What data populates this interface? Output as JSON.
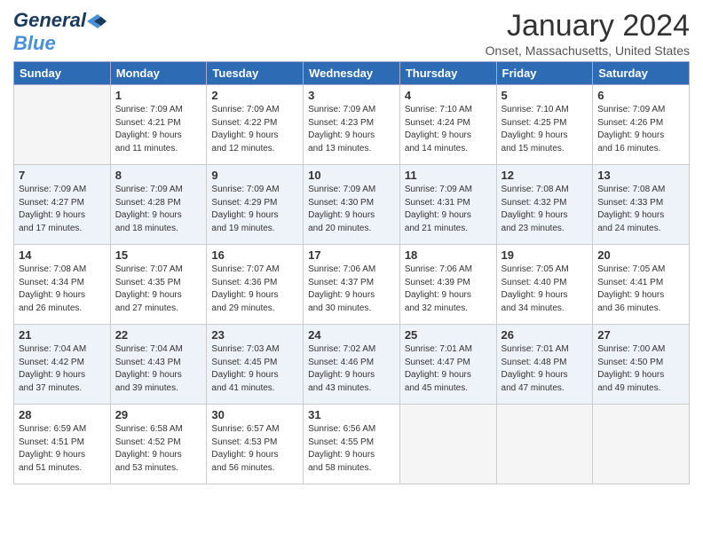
{
  "header": {
    "logo_general": "General",
    "logo_blue": "Blue",
    "title": "January 2024",
    "location": "Onset, Massachusetts, United States"
  },
  "weekdays": [
    "Sunday",
    "Monday",
    "Tuesday",
    "Wednesday",
    "Thursday",
    "Friday",
    "Saturday"
  ],
  "weeks": [
    [
      {
        "day": "",
        "info": ""
      },
      {
        "day": "1",
        "info": "Sunrise: 7:09 AM\nSunset: 4:21 PM\nDaylight: 9 hours\nand 11 minutes."
      },
      {
        "day": "2",
        "info": "Sunrise: 7:09 AM\nSunset: 4:22 PM\nDaylight: 9 hours\nand 12 minutes."
      },
      {
        "day": "3",
        "info": "Sunrise: 7:09 AM\nSunset: 4:23 PM\nDaylight: 9 hours\nand 13 minutes."
      },
      {
        "day": "4",
        "info": "Sunrise: 7:10 AM\nSunset: 4:24 PM\nDaylight: 9 hours\nand 14 minutes."
      },
      {
        "day": "5",
        "info": "Sunrise: 7:10 AM\nSunset: 4:25 PM\nDaylight: 9 hours\nand 15 minutes."
      },
      {
        "day": "6",
        "info": "Sunrise: 7:09 AM\nSunset: 4:26 PM\nDaylight: 9 hours\nand 16 minutes."
      }
    ],
    [
      {
        "day": "7",
        "info": "Sunrise: 7:09 AM\nSunset: 4:27 PM\nDaylight: 9 hours\nand 17 minutes."
      },
      {
        "day": "8",
        "info": "Sunrise: 7:09 AM\nSunset: 4:28 PM\nDaylight: 9 hours\nand 18 minutes."
      },
      {
        "day": "9",
        "info": "Sunrise: 7:09 AM\nSunset: 4:29 PM\nDaylight: 9 hours\nand 19 minutes."
      },
      {
        "day": "10",
        "info": "Sunrise: 7:09 AM\nSunset: 4:30 PM\nDaylight: 9 hours\nand 20 minutes."
      },
      {
        "day": "11",
        "info": "Sunrise: 7:09 AM\nSunset: 4:31 PM\nDaylight: 9 hours\nand 21 minutes."
      },
      {
        "day": "12",
        "info": "Sunrise: 7:08 AM\nSunset: 4:32 PM\nDaylight: 9 hours\nand 23 minutes."
      },
      {
        "day": "13",
        "info": "Sunrise: 7:08 AM\nSunset: 4:33 PM\nDaylight: 9 hours\nand 24 minutes."
      }
    ],
    [
      {
        "day": "14",
        "info": "Sunrise: 7:08 AM\nSunset: 4:34 PM\nDaylight: 9 hours\nand 26 minutes."
      },
      {
        "day": "15",
        "info": "Sunrise: 7:07 AM\nSunset: 4:35 PM\nDaylight: 9 hours\nand 27 minutes."
      },
      {
        "day": "16",
        "info": "Sunrise: 7:07 AM\nSunset: 4:36 PM\nDaylight: 9 hours\nand 29 minutes."
      },
      {
        "day": "17",
        "info": "Sunrise: 7:06 AM\nSunset: 4:37 PM\nDaylight: 9 hours\nand 30 minutes."
      },
      {
        "day": "18",
        "info": "Sunrise: 7:06 AM\nSunset: 4:39 PM\nDaylight: 9 hours\nand 32 minutes."
      },
      {
        "day": "19",
        "info": "Sunrise: 7:05 AM\nSunset: 4:40 PM\nDaylight: 9 hours\nand 34 minutes."
      },
      {
        "day": "20",
        "info": "Sunrise: 7:05 AM\nSunset: 4:41 PM\nDaylight: 9 hours\nand 36 minutes."
      }
    ],
    [
      {
        "day": "21",
        "info": "Sunrise: 7:04 AM\nSunset: 4:42 PM\nDaylight: 9 hours\nand 37 minutes."
      },
      {
        "day": "22",
        "info": "Sunrise: 7:04 AM\nSunset: 4:43 PM\nDaylight: 9 hours\nand 39 minutes."
      },
      {
        "day": "23",
        "info": "Sunrise: 7:03 AM\nSunset: 4:45 PM\nDaylight: 9 hours\nand 41 minutes."
      },
      {
        "day": "24",
        "info": "Sunrise: 7:02 AM\nSunset: 4:46 PM\nDaylight: 9 hours\nand 43 minutes."
      },
      {
        "day": "25",
        "info": "Sunrise: 7:01 AM\nSunset: 4:47 PM\nDaylight: 9 hours\nand 45 minutes."
      },
      {
        "day": "26",
        "info": "Sunrise: 7:01 AM\nSunset: 4:48 PM\nDaylight: 9 hours\nand 47 minutes."
      },
      {
        "day": "27",
        "info": "Sunrise: 7:00 AM\nSunset: 4:50 PM\nDaylight: 9 hours\nand 49 minutes."
      }
    ],
    [
      {
        "day": "28",
        "info": "Sunrise: 6:59 AM\nSunset: 4:51 PM\nDaylight: 9 hours\nand 51 minutes."
      },
      {
        "day": "29",
        "info": "Sunrise: 6:58 AM\nSunset: 4:52 PM\nDaylight: 9 hours\nand 53 minutes."
      },
      {
        "day": "30",
        "info": "Sunrise: 6:57 AM\nSunset: 4:53 PM\nDaylight: 9 hours\nand 56 minutes."
      },
      {
        "day": "31",
        "info": "Sunrise: 6:56 AM\nSunset: 4:55 PM\nDaylight: 9 hours\nand 58 minutes."
      },
      {
        "day": "",
        "info": ""
      },
      {
        "day": "",
        "info": ""
      },
      {
        "day": "",
        "info": ""
      }
    ]
  ]
}
